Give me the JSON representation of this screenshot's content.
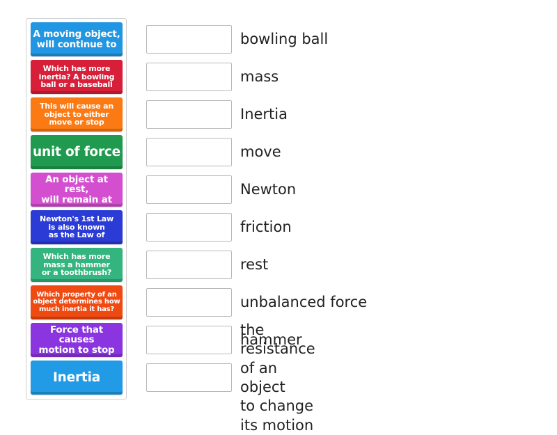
{
  "prompts": [
    {
      "text": "A moving object,\nwill continue to",
      "color": "#2196e3",
      "size": "l"
    },
    {
      "text": "Which has more\ninertia? A bowling\nball or a baseball",
      "color": "#d81f3a",
      "size": "m"
    },
    {
      "text": "This will cause an\nobject to either\nmove or stop",
      "color": "#fb7a14",
      "size": "m"
    },
    {
      "text": "unit of force",
      "color": "#1f9a4e",
      "size": "xl"
    },
    {
      "text": "An object at rest,\nwill remain at",
      "color": "#d44fd0",
      "size": "l"
    },
    {
      "text": "Newton's 1st Law\nis also known\nas the Law of",
      "color": "#2a3bd6",
      "size": "m"
    },
    {
      "text": "Which has more\nmass a hammer\nor a toothbrush?",
      "color": "#34b47e",
      "size": "m"
    },
    {
      "text": "Which property of an\nobject determines how\nmuch inertia it has?",
      "color": "#ef4a12",
      "size": "s"
    },
    {
      "text": "Force that causes\nmotion to stop",
      "color": "#8a35e0",
      "size": "l"
    },
    {
      "text": "Inertia",
      "color": "#219be6",
      "size": "xl"
    }
  ],
  "answers": [
    "bowling ball",
    "mass",
    "Inertia",
    "move",
    "Newton",
    "friction",
    "rest",
    "unbalanced force",
    "hammer",
    "the resistance of an object\nto change its motion"
  ]
}
